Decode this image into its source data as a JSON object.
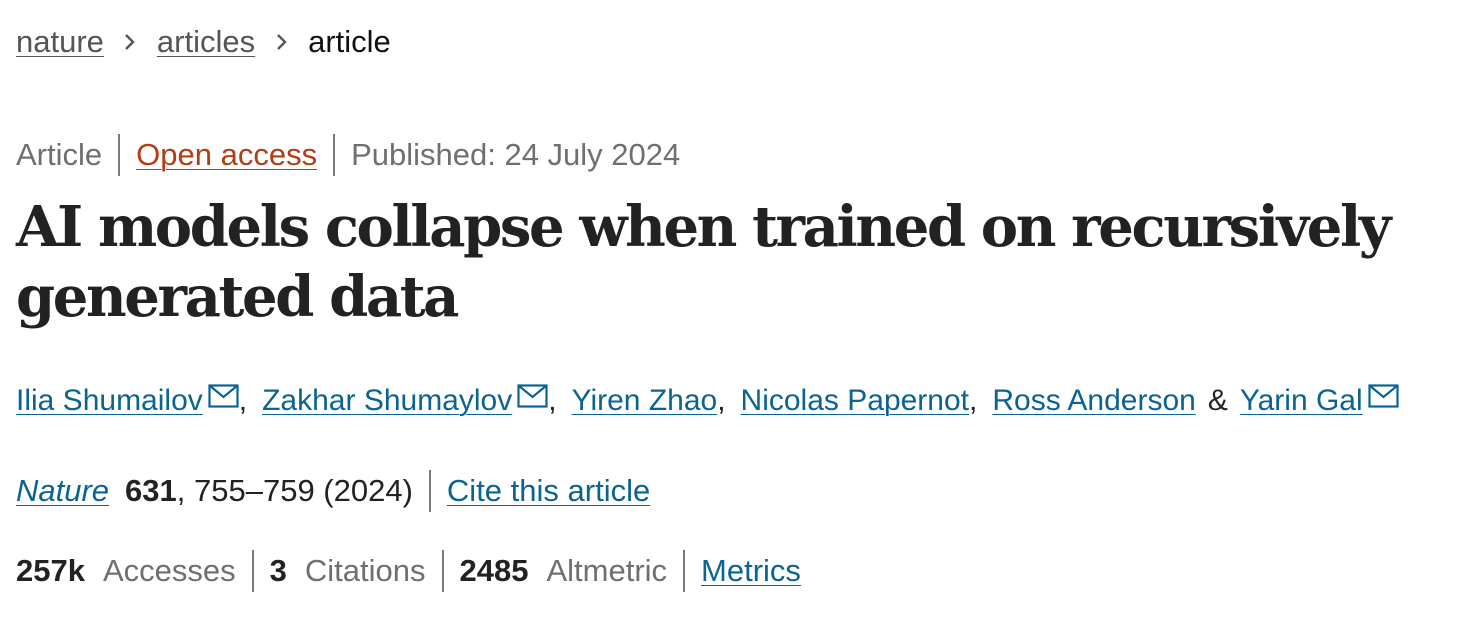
{
  "breadcrumb": {
    "items": [
      {
        "label": "nature"
      },
      {
        "label": "articles"
      },
      {
        "label": "article"
      }
    ]
  },
  "article_info": {
    "type": "Article",
    "access": "Open access",
    "published": "Published: 24 July 2024"
  },
  "title": "AI models collapse when trained on recursively generated data",
  "authors": {
    "list": [
      {
        "name": "Ilia Shumailov",
        "has_email": true
      },
      {
        "name": "Zakhar Shumaylov",
        "has_email": true
      },
      {
        "name": "Yiren Zhao",
        "has_email": false
      },
      {
        "name": "Nicolas Papernot",
        "has_email": false
      },
      {
        "name": "Ross Anderson",
        "has_email": false
      },
      {
        "name": "Yarin Gal",
        "has_email": true
      }
    ],
    "separator": ",",
    "conjunction": "&"
  },
  "citation": {
    "journal": "Nature",
    "volume": "631",
    "pages_year": ", 755–759 (2024)",
    "cite_label": "Cite this article"
  },
  "metrics": {
    "accesses": {
      "value": "257k",
      "label": "Accesses"
    },
    "citations": {
      "value": "3",
      "label": "Citations"
    },
    "altmetric": {
      "value": "2485",
      "label": "Altmetric"
    },
    "link_label": "Metrics"
  },
  "colors": {
    "link": "#0b6391",
    "open_access": "#b23d15",
    "muted_text": "#6f6f6f",
    "body_text": "#222222"
  },
  "icons": {
    "breadcrumb_separator": "chevron-right-icon",
    "author_email": "envelope-icon"
  }
}
